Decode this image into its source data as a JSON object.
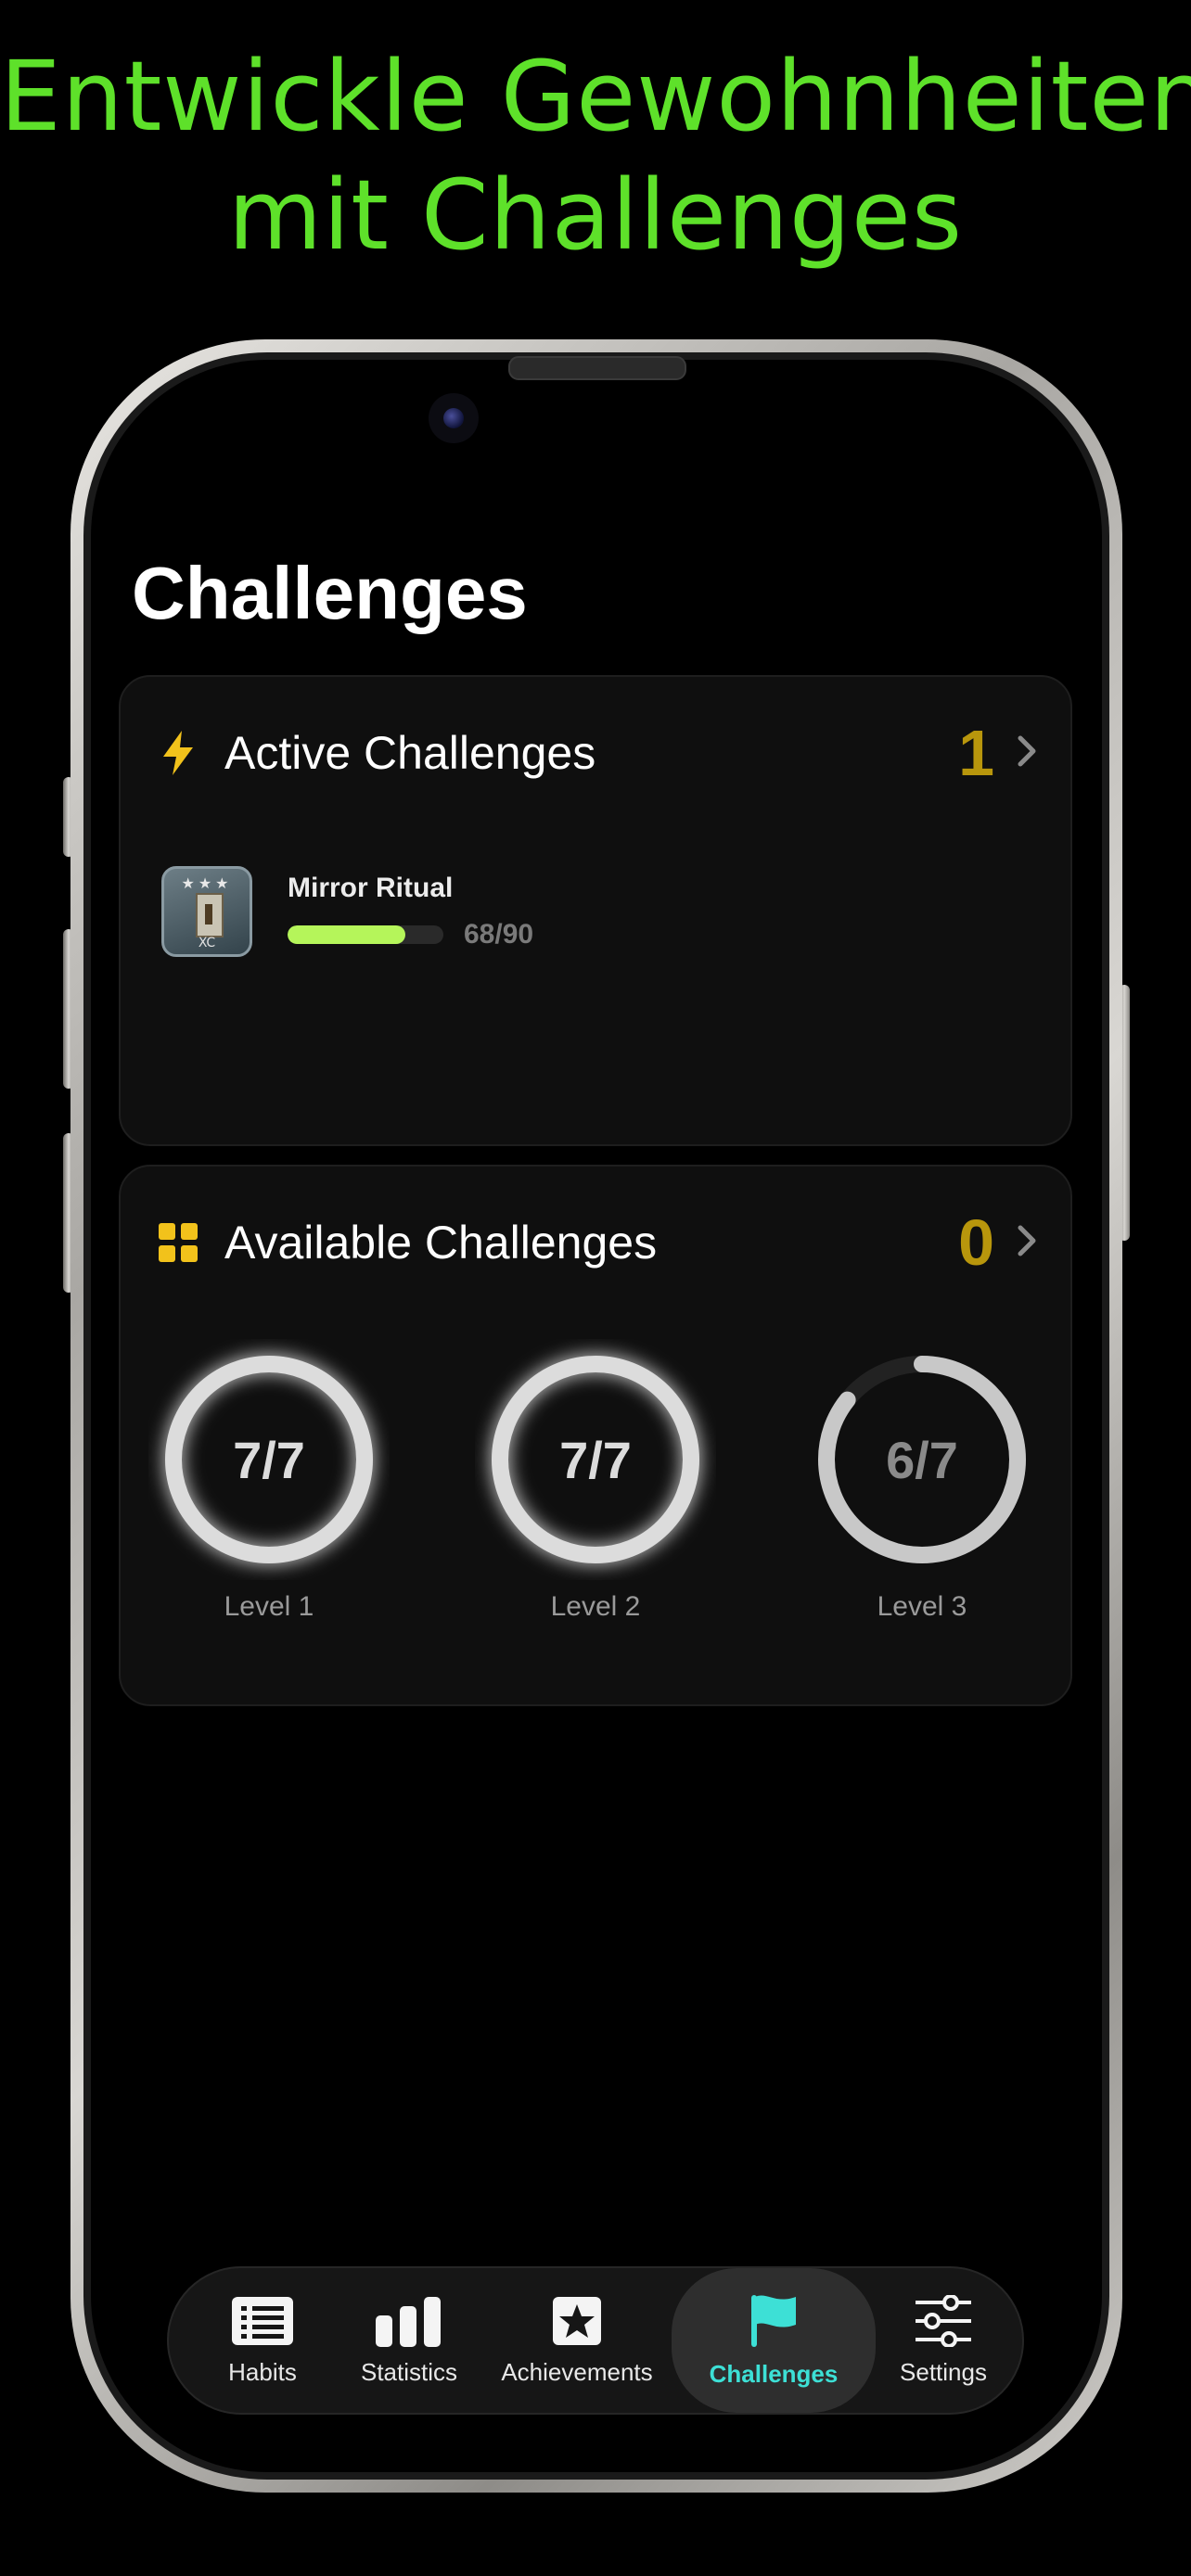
{
  "headline": {
    "line1": "Entwickle Gewohnheiten",
    "line2": "mit Challenges"
  },
  "page": {
    "title": "Challenges"
  },
  "active_card": {
    "title": "Active Challenges",
    "count": "1",
    "items": [
      {
        "name": "Mirror Ritual",
        "progress_text": "68/90",
        "progress": 0.755,
        "badge_text": "XC"
      }
    ]
  },
  "available_card": {
    "title": "Available Challenges",
    "count": "0",
    "levels": [
      {
        "ring_text": "7/7",
        "label": "Level 1",
        "done": 7,
        "total": 7
      },
      {
        "ring_text": "7/7",
        "label": "Level 2",
        "done": 7,
        "total": 7
      },
      {
        "ring_text": "6/7",
        "label": "Level 3",
        "done": 6,
        "total": 7
      }
    ]
  },
  "tabbar": {
    "tabs": [
      {
        "label": "Habits",
        "icon": "list-icon"
      },
      {
        "label": "Statistics",
        "icon": "bar-chart-icon"
      },
      {
        "label": "Achievements",
        "icon": "star-icon"
      },
      {
        "label": "Challenges",
        "icon": "flag-icon",
        "active": true
      },
      {
        "label": "Settings",
        "icon": "sliders-icon"
      }
    ]
  },
  "colors": {
    "headline": "#5ee12a",
    "count": "#b8960c",
    "progress": "#b5f55a",
    "active_tab": "#3de0d6",
    "icon_yellow": "#f2c21b"
  }
}
